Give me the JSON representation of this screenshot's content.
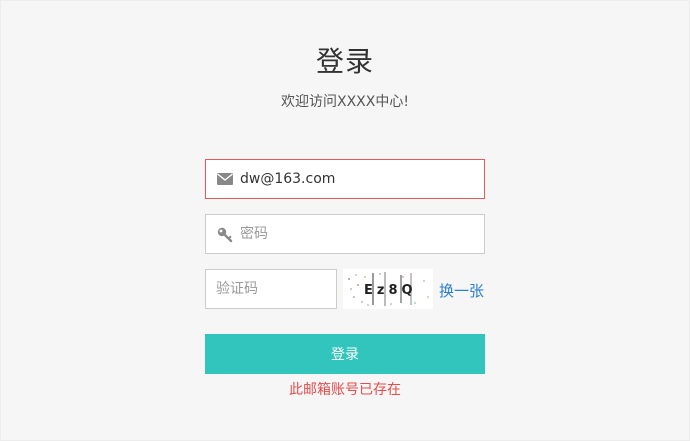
{
  "header": {
    "title": "登录",
    "subtitle": "欢迎访问XXXX中心!"
  },
  "form": {
    "email": {
      "value": "dw@163.com",
      "placeholder": "",
      "icon": "envelope-icon"
    },
    "password": {
      "value": "",
      "placeholder": "密码",
      "icon": "key-icon"
    },
    "captcha": {
      "value": "",
      "placeholder": "验证码",
      "image_text": "Ez8Q",
      "change_label": "换一张"
    },
    "login_label": "登录",
    "error_message": "此邮箱账号已存在"
  },
  "colors": {
    "accent": "#32c5bd",
    "error": "#e74c4c",
    "link": "#2a7fd3",
    "error_border": "#e45b5b"
  }
}
